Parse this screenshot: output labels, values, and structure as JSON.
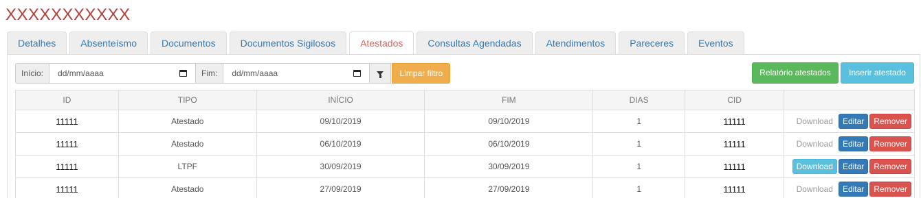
{
  "page": {
    "title": "XXXXXXXXXXX"
  },
  "tabs": [
    {
      "label": "Detalhes",
      "active": false
    },
    {
      "label": "Absenteísmo",
      "active": false
    },
    {
      "label": "Documentos",
      "active": false
    },
    {
      "label": "Documentos Sigilosos",
      "active": false
    },
    {
      "label": "Atestados",
      "active": true
    },
    {
      "label": "Consultas Agendadas",
      "active": false
    },
    {
      "label": "Atendimentos",
      "active": false
    },
    {
      "label": "Pareceres",
      "active": false
    },
    {
      "label": "Eventos",
      "active": false
    }
  ],
  "filter": {
    "start_label": "Início:",
    "start_value": "dd/mm/aaaa",
    "end_label": "Fim:",
    "end_value": "dd/mm/aaaa",
    "filter_icon": "funnel-icon",
    "clear_label": "Limpar filtro"
  },
  "actions": {
    "report_label": "Relatório atestados",
    "insert_label": "Inserir atestado"
  },
  "table": {
    "headers": [
      "ID",
      "TIPO",
      "INÍCIO",
      "FIM",
      "DIAS",
      "CID",
      ""
    ],
    "row_actions": {
      "download": "Download",
      "edit": "Editar",
      "remove": "Remover"
    },
    "rows": [
      {
        "id": "11111",
        "tipo": "Atestado",
        "inicio": "09/10/2019",
        "fim": "09/10/2019",
        "dias": "1",
        "cid": "11111",
        "download_enabled": false
      },
      {
        "id": "11111",
        "tipo": "Atestado",
        "inicio": "06/10/2019",
        "fim": "06/10/2019",
        "dias": "1",
        "cid": "11111",
        "download_enabled": false
      },
      {
        "id": "11111",
        "tipo": "LTPF",
        "inicio": "30/09/2019",
        "fim": "30/09/2019",
        "dias": "1",
        "cid": "11111",
        "download_enabled": true
      },
      {
        "id": "11111",
        "tipo": "Atestado",
        "inicio": "27/09/2019",
        "fim": "27/09/2019",
        "dias": "1",
        "cid": "11111",
        "download_enabled": false
      }
    ]
  },
  "colors": {
    "title": "#b5403a",
    "active_tab": "#e0645c",
    "link": "#337ab7",
    "warning": "#f0ad4e",
    "success": "#5cb85c",
    "info": "#5bc0de",
    "danger": "#d9534f"
  }
}
